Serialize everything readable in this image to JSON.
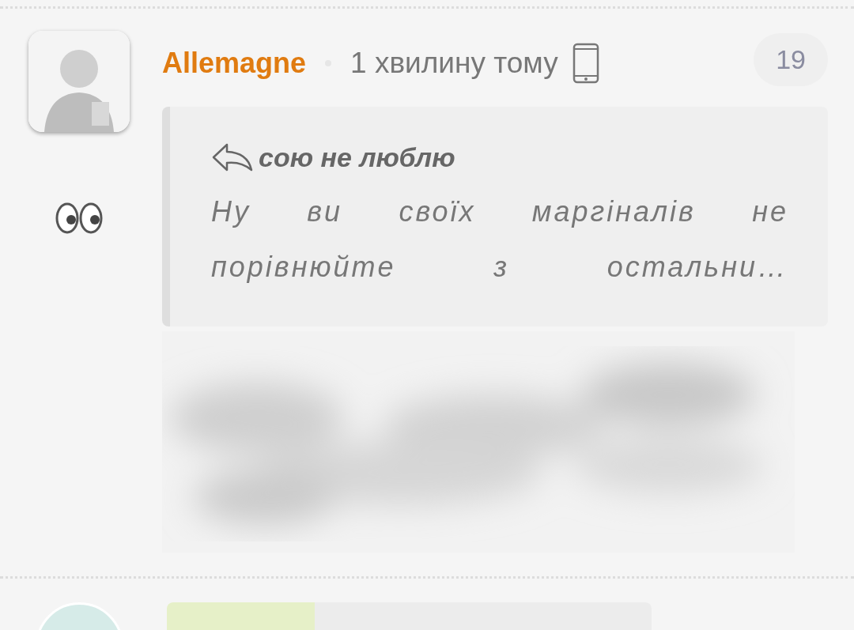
{
  "comment": {
    "author": "Allemagne",
    "time": "1 хвилину тому",
    "count": "19",
    "quote": {
      "author": "сою не люблю",
      "text": "Ну ви своїх маргіналів не порівнюйте з остальни…"
    }
  }
}
